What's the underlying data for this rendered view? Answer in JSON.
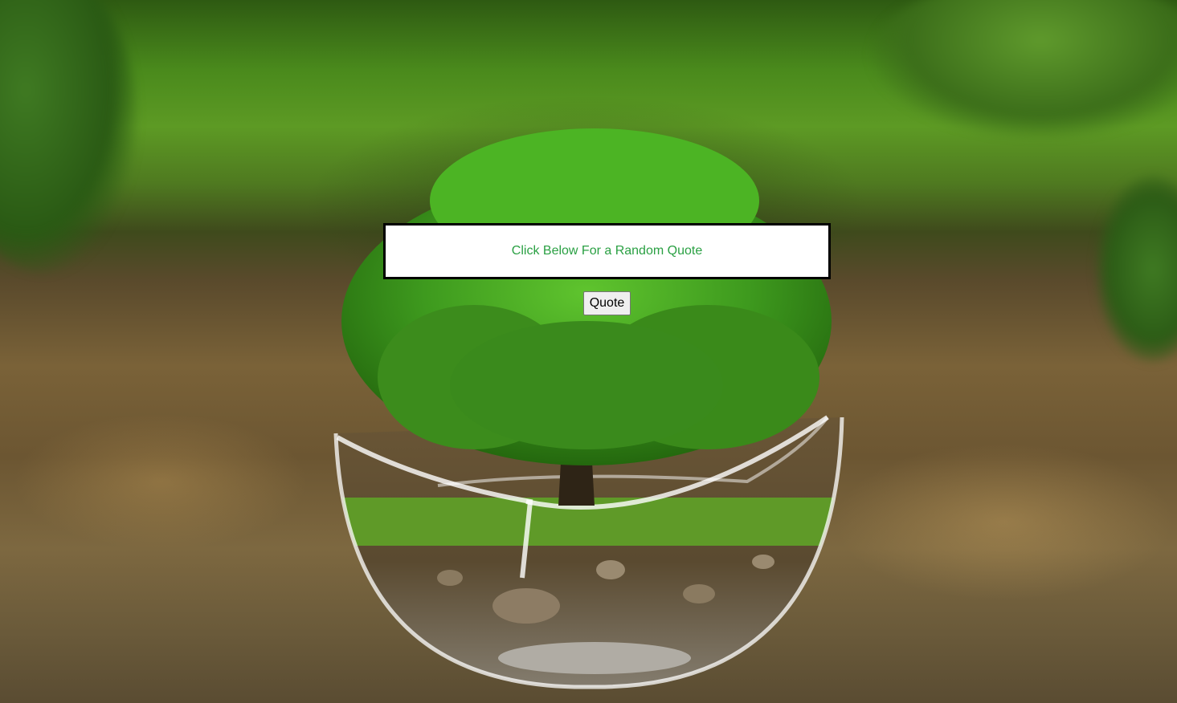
{
  "quote": {
    "text": "Click Below For a Random Quote"
  },
  "button": {
    "label": "Quote"
  },
  "colors": {
    "quote_text": "#2aa043",
    "quote_border": "#000000",
    "quote_background": "#ffffff"
  },
  "background": {
    "image_icon": "tree-in-glass-sphere-image"
  }
}
